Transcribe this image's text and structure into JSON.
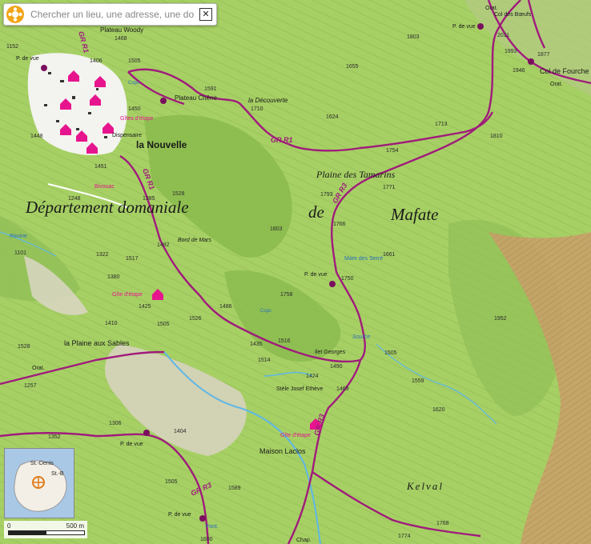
{
  "search": {
    "placeholder": "Chercher un lieu, une adresse, une donnée",
    "close_label": "✕"
  },
  "scale": {
    "zero": "0",
    "max": "500 m"
  },
  "minimap": {
    "label_north": "St.-Denis",
    "label_east": "St.-B"
  },
  "map_labels": {
    "region_dept": "Département domaniale",
    "region_de": "de",
    "region_mafate": "Mafate",
    "plaine": "Plaine des Tamarins",
    "la_nouvelle": "la Nouvelle",
    "plateau_woody": "Plateau Woody",
    "plateau_chene": "Plateau Chêne",
    "la_decouverte": "la Découverte",
    "col_fourche": "Col de Fourche",
    "col_boeufs": "Col des Bœufs",
    "la_plaine_sables": "la Plaine aux Sables",
    "maison_laclos": "Maison Laclos",
    "kelval": "Kelval",
    "bord_mars": "Bord de Mars",
    "gite_etape": "Gîte d'étape",
    "gite_etape2": "Gîte d'étape",
    "gites_etape": "Gîtes d'étape",
    "dispensaire": "Dispensaire",
    "mare_serre": "Mare des Serré",
    "ilet_georges": "Ilet Georges",
    "stele": "Stèle Josef Ethève",
    "bivouac": "Bivouac",
    "orat1": "Orat.",
    "orat2": "Orat.",
    "orat3": "Orat.",
    "pv1": "P. de vue",
    "pv2": "P. de vue",
    "pv3": "P. de vue",
    "pv4": "P. de vue",
    "pv5": "P. de vue",
    "grr1a": "GR R1",
    "grr1b": "GR R1",
    "grr3a": "GR R3",
    "grr3b": "GR R3",
    "grr3c": "GR R3",
    "grr1c": "GR R1",
    "chap": "Chap.",
    "font": "Font.",
    "ravine": "Ravine",
    "source": "Source",
    "copc1": "Copc",
    "copc2": "Copc"
  },
  "elevations": [
    "1468",
    "1406",
    "1505",
    "1450",
    "1591",
    "1710",
    "1624",
    "1655",
    "1803",
    "1713",
    "1754",
    "1810",
    "1793",
    "1771",
    "1766",
    "1803",
    "1661",
    "1750",
    "1758",
    "1528",
    "1385",
    "1482",
    "1517",
    "1380",
    "1425",
    "1486",
    "1526",
    "1505",
    "1435",
    "1516",
    "1514",
    "1490",
    "1424",
    "1469",
    "1505",
    "1559",
    "1620",
    "1952",
    "1410",
    "1528",
    "1257",
    "1306",
    "1404",
    "1505",
    "1589",
    "1600",
    "1774",
    "1768",
    "2011",
    "1993",
    "1877",
    "1946",
    "1448",
    "1451",
    "1248",
    "1101",
    "1152",
    "1322",
    "1352"
  ]
}
